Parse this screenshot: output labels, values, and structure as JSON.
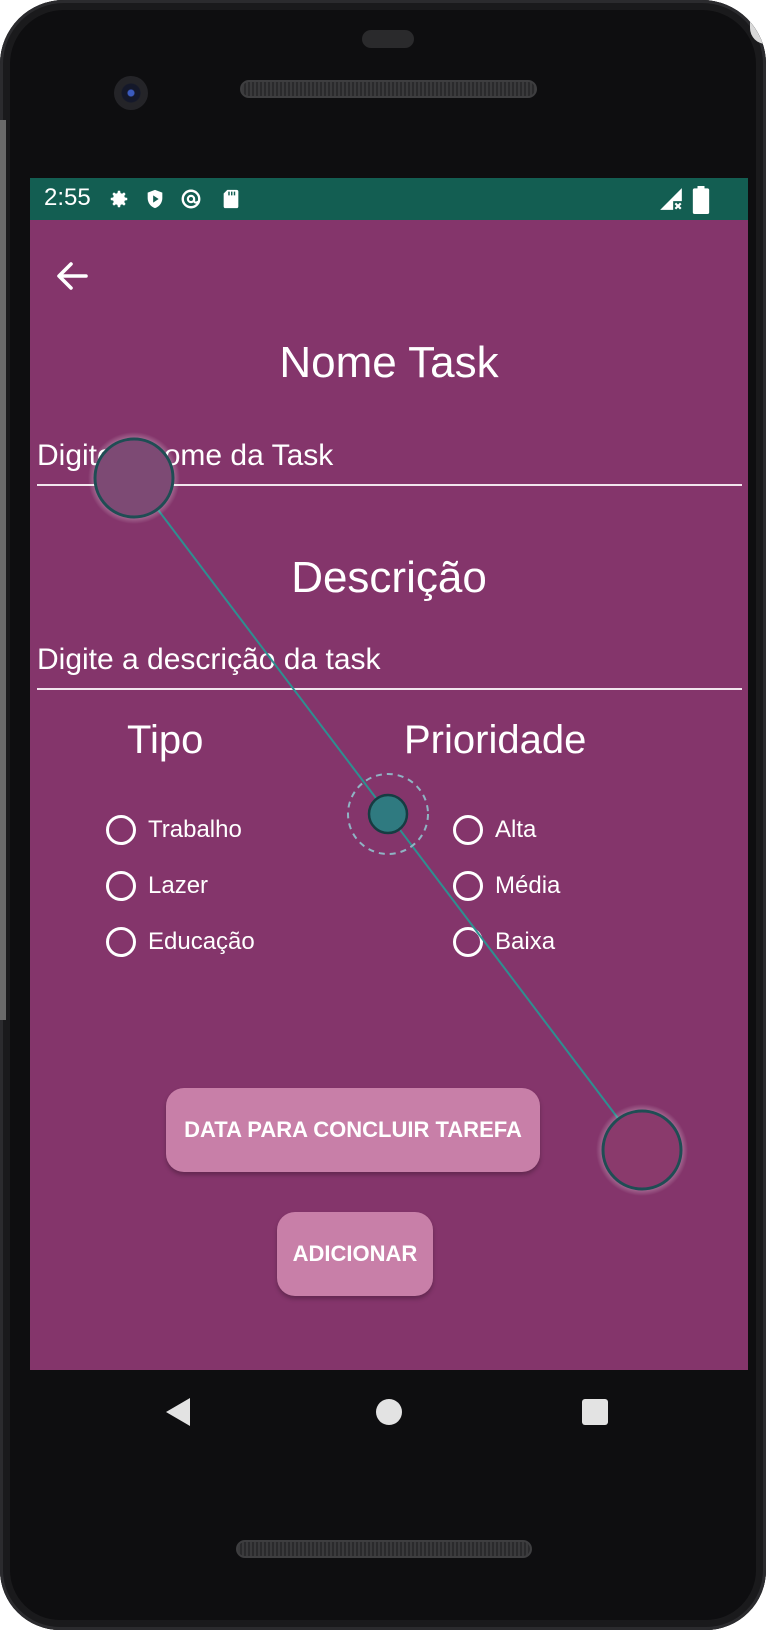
{
  "status_bar": {
    "time": "2:55",
    "icons": [
      "settings-icon",
      "shield-play-icon",
      "at-sync-icon",
      "sd-card-icon"
    ],
    "right_icons": [
      "signal-no-data-icon",
      "battery-icon"
    ],
    "background": "#135e52"
  },
  "app": {
    "background": "#84356b",
    "back_icon": "arrow-left-icon",
    "name_section": {
      "title": "Nome Task",
      "input_placeholder": "Digite o nome da Task"
    },
    "description_section": {
      "title": "Descrição",
      "input_placeholder": "Digite a descrição da task"
    },
    "type_group": {
      "title": "Tipo",
      "options": [
        "Trabalho",
        "Lazer",
        "Educação"
      ]
    },
    "priority_group": {
      "title": "Prioridade",
      "options": [
        "Alta",
        "Média",
        "Baixa"
      ]
    },
    "buttons": {
      "due_date": "DATA PARA CONCLUIR TAREFA",
      "add": "ADICIONAR",
      "color": "#c87fa8"
    }
  },
  "nav_bar": {
    "icons": [
      "back-triangle-icon",
      "home-circle-icon",
      "recents-square-icon"
    ]
  },
  "gesture_overlay": {
    "type": "drag",
    "color": "#2e7d80"
  }
}
